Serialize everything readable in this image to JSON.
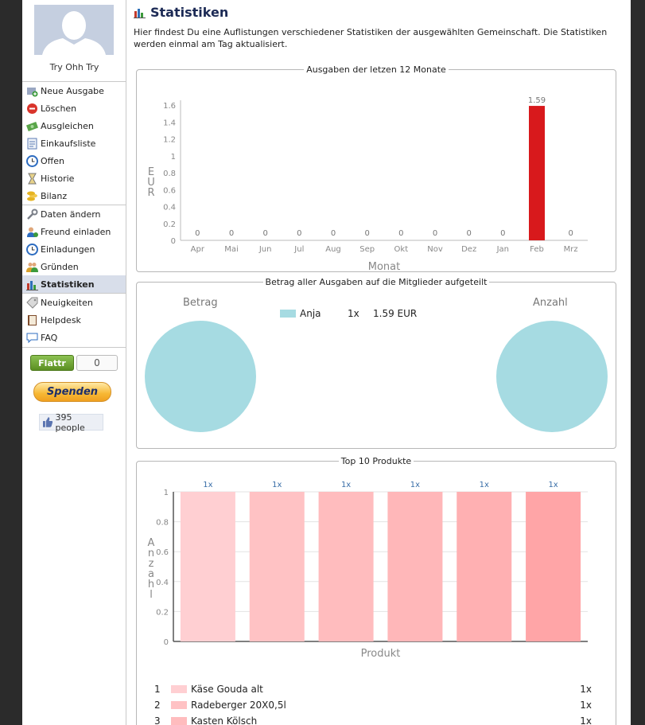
{
  "profile": {
    "name": "Try Ohh Try"
  },
  "sidebar": {
    "menu_groups": [
      [
        {
          "label": "Neue Ausgabe",
          "icon": "add-expense-icon"
        },
        {
          "label": "Löschen",
          "icon": "delete-icon"
        },
        {
          "label": "Ausgleichen",
          "icon": "money-icon"
        },
        {
          "label": "Einkaufsliste",
          "icon": "notepad-icon"
        },
        {
          "label": "Offen",
          "icon": "clock-icon"
        },
        {
          "label": "Historie",
          "icon": "hourglass-icon"
        },
        {
          "label": "Bilanz",
          "icon": "coins-icon"
        }
      ],
      [
        {
          "label": "Daten ändern",
          "icon": "wrench-icon"
        },
        {
          "label": "Freund einladen",
          "icon": "invite-friend-icon"
        },
        {
          "label": "Einladungen",
          "icon": "clock-icon"
        },
        {
          "label": "Gründen",
          "icon": "group-icon"
        },
        {
          "label": "Statistiken",
          "icon": "chart-icon",
          "active": true
        }
      ],
      [
        {
          "label": "Neuigkeiten",
          "icon": "tag-icon"
        },
        {
          "label": "Helpdesk",
          "icon": "book-icon"
        },
        {
          "label": "FAQ",
          "icon": "speech-bubble-icon"
        }
      ]
    ],
    "flattr_label": "Flattr",
    "flattr_count": "0",
    "donate_label": "Spenden",
    "like_text": "395 people"
  },
  "main": {
    "title": "Statistiken",
    "intro": "Hier findest Du eine Auflistungen verschiedener Statistiken der ausgewählten Gemeinschaft. Die Statistiken werden einmal am Tag aktualisiert.",
    "panel1_legend": "Ausgaben der letzen 12 Monate",
    "panel2_legend": "Betrag aller Ausgaben auf die Mitglieder aufgeteilt",
    "panel3_legend": "Top 10 Produkte",
    "pie_left_label": "Betrag",
    "pie_right_label": "Anzahl",
    "member_legend": {
      "name": "Anja",
      "count": "1x",
      "amount": "1.59 EUR"
    },
    "products": [
      {
        "rank": "1",
        "name": "Käse Gouda alt",
        "count": "1x"
      },
      {
        "rank": "2",
        "name": "Radeberger 20X0,5l",
        "count": "1x"
      },
      {
        "rank": "3",
        "name": "Kasten Kölsch",
        "count": "1x"
      }
    ]
  },
  "colors": {
    "accent_bar": "#d8191c",
    "pie": "#a6dbe2",
    "product_bars": [
      "#ffcfd2",
      "#ffc2c4",
      "#ffbcbe",
      "#ffb7b9",
      "#ffb0b2",
      "#ffa5a7"
    ]
  },
  "chart_data": [
    {
      "type": "bar",
      "title": "Ausgaben der letzen 12 Monate",
      "categories": [
        "Apr",
        "Mai",
        "Jun",
        "Jul",
        "Aug",
        "Sep",
        "Okt",
        "Nov",
        "Dez",
        "Jan",
        "Feb",
        "Mrz"
      ],
      "values": [
        0,
        0,
        0,
        0,
        0,
        0,
        0,
        0,
        0,
        0,
        1.59,
        0
      ],
      "data_labels": [
        "0",
        "0",
        "0",
        "0",
        "0",
        "0",
        "0",
        "0",
        "0",
        "0",
        "1.59",
        "0"
      ],
      "xlabel": "Monat",
      "ylabel": "EUR",
      "ylim": [
        0,
        1.6
      ],
      "yticks": [
        "0",
        "0.2",
        "0.4",
        "0.6",
        "0.8",
        "1",
        "1.2",
        "1.4",
        "1.6"
      ]
    },
    {
      "type": "pie",
      "title": "Betrag",
      "labels": [
        "Anja"
      ],
      "values": [
        1.59
      ]
    },
    {
      "type": "pie",
      "title": "Anzahl",
      "labels": [
        "Anja"
      ],
      "values": [
        1
      ]
    },
    {
      "type": "bar",
      "title": "Top 10 Produkte",
      "values": [
        1,
        1,
        1,
        1,
        1,
        1
      ],
      "data_labels": [
        "1x",
        "1x",
        "1x",
        "1x",
        "1x",
        "1x"
      ],
      "xlabel": "Produkt",
      "ylabel": "Anzahl",
      "ylim": [
        0,
        1
      ],
      "yticks": [
        "0",
        "0.2",
        "0.4",
        "0.6",
        "0.8",
        "1"
      ]
    }
  ]
}
